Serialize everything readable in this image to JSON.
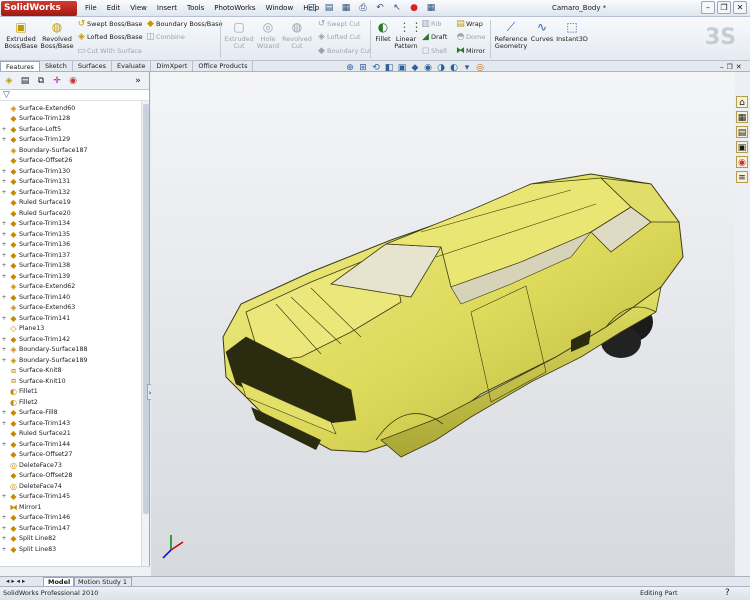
{
  "app": {
    "logo": "SolidWorks",
    "doc_title": "Camaro_Body *"
  },
  "menus": [
    "File",
    "Edit",
    "View",
    "Insert",
    "Tools",
    "PhotoWorks",
    "Window",
    "Help"
  ],
  "quick_access": [
    {
      "icon": "new-doc-icon",
      "glyph": "□"
    },
    {
      "icon": "open-icon",
      "glyph": "▤"
    },
    {
      "icon": "save-icon",
      "glyph": "▦"
    },
    {
      "icon": "print-icon",
      "glyph": "⎙"
    },
    {
      "icon": "undo-icon",
      "glyph": "↶"
    },
    {
      "icon": "select-icon",
      "glyph": "↖"
    },
    {
      "icon": "rebuild-icon",
      "glyph": "●"
    },
    {
      "icon": "options-icon",
      "glyph": "▦"
    }
  ],
  "ribbon": {
    "extruded_boss": "Extruded Boss/Base",
    "revolved_boss": "Revolved Boss/Base",
    "swept_boss": "Swept Boss/Base",
    "lofted_boss": "Lofted Boss/Base",
    "boundary_boss": "Boundary Boss/Base",
    "cut_with_surface": "Cut With Surface",
    "combine": "Combine",
    "extruded_cut": "Extruded Cut",
    "hole_wizard": "Hole Wizard",
    "revolved_cut": "Revolved Cut",
    "swept_cut": "Swept Cut",
    "lofted_cut": "Lofted Cut",
    "boundary_cut": "Boundary Cut",
    "fillet": "Fillet",
    "linear_pattern": "Linear Pattern",
    "rib": "Rib",
    "draft": "Draft",
    "shell": "Shell",
    "wrap": "Wrap",
    "dome": "Dome",
    "mirror": "Mirror",
    "reference_geometry": "Reference Geometry",
    "curves": "Curves",
    "instant3d": "Instant3D"
  },
  "command_tabs": [
    "Features",
    "Sketch",
    "Surfaces",
    "Evaluate",
    "DimXpert",
    "Office Products"
  ],
  "feature_tree": [
    {
      "label": "Surface-Extend60",
      "icon": "surface-extend-icon",
      "glyph": "◈",
      "expand": ""
    },
    {
      "label": "Surface-Trim128",
      "icon": "surface-trim-icon",
      "glyph": "◆",
      "expand": ""
    },
    {
      "label": "Surface-Loft5",
      "icon": "surface-loft-icon",
      "glyph": "◆",
      "expand": "+"
    },
    {
      "label": "Surface-Trim129",
      "icon": "surface-trim-icon",
      "glyph": "◆",
      "expand": "+"
    },
    {
      "label": "Boundary-Surface187",
      "icon": "boundary-surface-icon",
      "glyph": "◈",
      "expand": ""
    },
    {
      "label": "Surface-Offset26",
      "icon": "surface-offset-icon",
      "glyph": "◆",
      "expand": ""
    },
    {
      "label": "Surface-Trim130",
      "icon": "surface-trim-icon",
      "glyph": "◆",
      "expand": "+"
    },
    {
      "label": "Surface-Trim131",
      "icon": "surface-trim-icon",
      "glyph": "◆",
      "expand": "+"
    },
    {
      "label": "Surface-Trim132",
      "icon": "surface-trim-icon",
      "glyph": "◆",
      "expand": "+"
    },
    {
      "label": "Ruled Surface19",
      "icon": "ruled-surface-icon",
      "glyph": "◆",
      "expand": ""
    },
    {
      "label": "Ruled Surface20",
      "icon": "ruled-surface-icon",
      "glyph": "◆",
      "expand": ""
    },
    {
      "label": "Surface-Trim134",
      "icon": "surface-trim-icon",
      "glyph": "◆",
      "expand": "+"
    },
    {
      "label": "Surface-Trim135",
      "icon": "surface-trim-icon",
      "glyph": "◆",
      "expand": "+"
    },
    {
      "label": "Surface-Trim136",
      "icon": "surface-trim-icon",
      "glyph": "◆",
      "expand": "+"
    },
    {
      "label": "Surface-Trim137",
      "icon": "surface-trim-icon",
      "glyph": "◆",
      "expand": "+"
    },
    {
      "label": "Surface-Trim138",
      "icon": "surface-trim-icon",
      "glyph": "◆",
      "expand": "+"
    },
    {
      "label": "Surface-Trim139",
      "icon": "surface-trim-icon",
      "glyph": "◆",
      "expand": "+"
    },
    {
      "label": "Surface-Extend62",
      "icon": "surface-extend-icon",
      "glyph": "◈",
      "expand": ""
    },
    {
      "label": "Surface-Trim140",
      "icon": "surface-trim-icon",
      "glyph": "◆",
      "expand": "+"
    },
    {
      "label": "Surface-Extend63",
      "icon": "surface-extend-icon",
      "glyph": "◈",
      "expand": ""
    },
    {
      "label": "Surface-Trim141",
      "icon": "surface-trim-icon",
      "glyph": "◆",
      "expand": "+"
    },
    {
      "label": "Plane13",
      "icon": "plane-icon",
      "glyph": "◇",
      "expand": ""
    },
    {
      "label": "Surface-Trim142",
      "icon": "surface-trim-icon",
      "glyph": "◆",
      "expand": "+"
    },
    {
      "label": "Boundary-Surface188",
      "icon": "boundary-surface-icon",
      "glyph": "◈",
      "expand": "+"
    },
    {
      "label": "Boundary-Surface189",
      "icon": "boundary-surface-icon",
      "glyph": "◈",
      "expand": "+"
    },
    {
      "label": "Surface-Knit8",
      "icon": "surface-knit-icon",
      "glyph": "⧈",
      "expand": ""
    },
    {
      "label": "Surface-Knit10",
      "icon": "surface-knit-icon",
      "glyph": "⧈",
      "expand": ""
    },
    {
      "label": "Fillet1",
      "icon": "fillet-icon",
      "glyph": "◐",
      "expand": ""
    },
    {
      "label": "Fillet2",
      "icon": "fillet-icon",
      "glyph": "◐",
      "expand": ""
    },
    {
      "label": "Surface-Fill8",
      "icon": "surface-fill-icon",
      "glyph": "◆",
      "expand": "+"
    },
    {
      "label": "Surface-Trim143",
      "icon": "surface-trim-icon",
      "glyph": "◆",
      "expand": "+"
    },
    {
      "label": "Ruled Surface21",
      "icon": "ruled-surface-icon",
      "glyph": "◆",
      "expand": ""
    },
    {
      "label": "Surface-Trim144",
      "icon": "surface-trim-icon",
      "glyph": "◆",
      "expand": "+"
    },
    {
      "label": "Surface-Offset27",
      "icon": "surface-offset-icon",
      "glyph": "◆",
      "expand": ""
    },
    {
      "label": "DeleteFace73",
      "icon": "delete-face-icon",
      "glyph": "◎",
      "expand": ""
    },
    {
      "label": "Surface-Offset28",
      "icon": "surface-offset-icon",
      "glyph": "◆",
      "expand": ""
    },
    {
      "label": "DeleteFace74",
      "icon": "delete-face-icon",
      "glyph": "◎",
      "expand": ""
    },
    {
      "label": "Surface-Trim145",
      "icon": "surface-trim-icon",
      "glyph": "◆",
      "expand": "+"
    },
    {
      "label": "Mirror1",
      "icon": "mirror-icon",
      "glyph": "⧓",
      "expand": ""
    },
    {
      "label": "Surface-Trim146",
      "icon": "surface-trim-icon",
      "glyph": "◆",
      "expand": "+"
    },
    {
      "label": "Surface-Trim147",
      "icon": "surface-trim-icon",
      "glyph": "◆",
      "expand": "+"
    },
    {
      "label": "Split Line82",
      "icon": "split-line-icon",
      "glyph": "◆",
      "expand": "+"
    },
    {
      "label": "Split Line83",
      "icon": "split-line-icon",
      "glyph": "◆",
      "expand": "+"
    }
  ],
  "bottom_tabs": [
    "Model",
    "Motion Study 1"
  ],
  "status": {
    "left": "SolidWorks Professional 2010",
    "mode": "Editing Part"
  },
  "colors": {
    "model_fill": "#e3e06a",
    "model_edge": "#3a3a12",
    "tire": "#1b1b1b"
  }
}
